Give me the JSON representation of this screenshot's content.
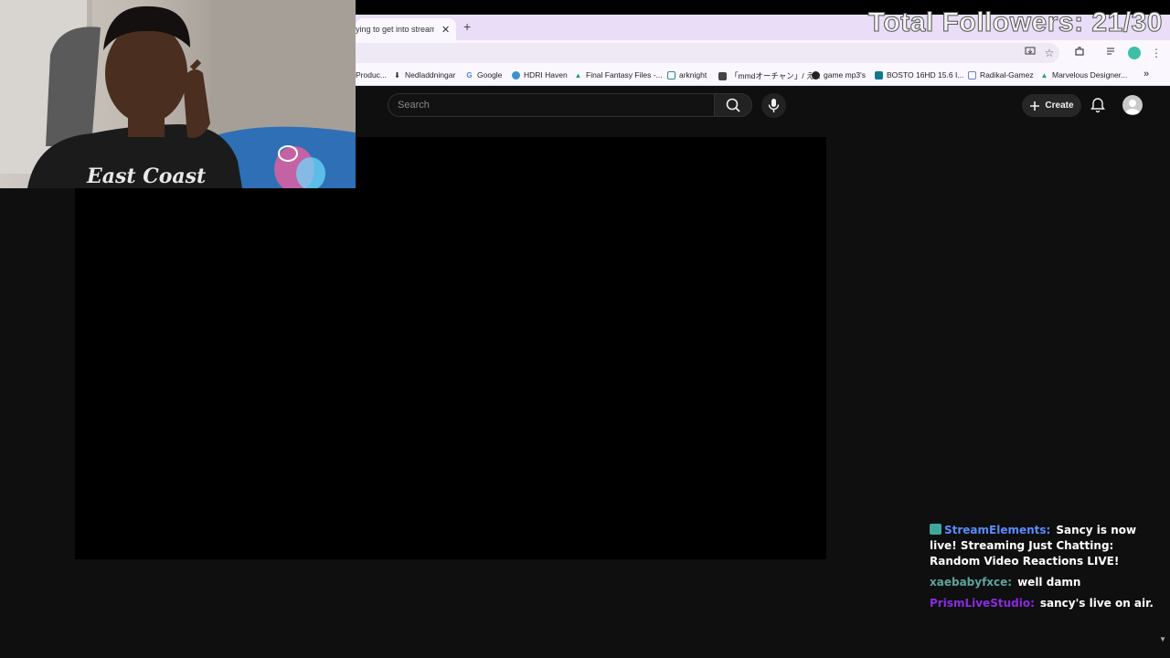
{
  "browser": {
    "tab_title": "ying to get into streamin",
    "tab_close": "✕",
    "new_tab": "+",
    "bookmarks": [
      {
        "label": "Produc...",
        "icon": "page-icon",
        "color": "#888888"
      },
      {
        "label": "Nedladdningar",
        "icon": "download-icon",
        "color": "#222222"
      },
      {
        "label": "Google",
        "icon": "google-icon",
        "color": "#4285f4"
      },
      {
        "label": "HDRI Haven",
        "icon": "hdri-icon",
        "color": "#3d8fd1"
      },
      {
        "label": "Final Fantasy Files -...",
        "icon": "drive-icon",
        "color": "#1fa463"
      },
      {
        "label": "arknight",
        "icon": "tv-icon",
        "color": "#2a8f86"
      },
      {
        "label": "「mmdオーチャン」/ え...",
        "icon": "film-icon",
        "color": "#444444"
      },
      {
        "label": "game mp3's",
        "icon": "globe-icon",
        "color": "#222222"
      },
      {
        "label": "BOSTO 16HD 15.6 I...",
        "icon": "bosto-icon",
        "color": "#127a8a"
      },
      {
        "label": "Radikal-Gamez",
        "icon": "page-icon",
        "color": "#6a7fcf"
      },
      {
        "label": "Marvelous Designer...",
        "icon": "drive-icon",
        "color": "#1fa463"
      }
    ],
    "more_bookmarks": "»"
  },
  "youtube": {
    "search_placeholder": "Search",
    "create_label": "Create"
  },
  "overlay": {
    "followers_text": "Total Followers: 21/30"
  },
  "chat": {
    "messages": [
      {
        "user": "StreamElements:",
        "text": "Sancy is now live! Streaming Just Chatting: Random Video Reactions LIVE!",
        "user_color": "#5b8cff",
        "has_bot_icon": true
      },
      {
        "user": "xaebabyfxce:",
        "text": "well damn",
        "user_color": "#5fa3a0"
      },
      {
        "user": "PrismLiveStudio:",
        "text": "sancy's live on air.",
        "user_color": "#8a2be2"
      }
    ]
  },
  "colors": {
    "page_bg": "#0f0f0f",
    "tab_strip": "#e9ddf7",
    "player_bg": "#000000"
  }
}
